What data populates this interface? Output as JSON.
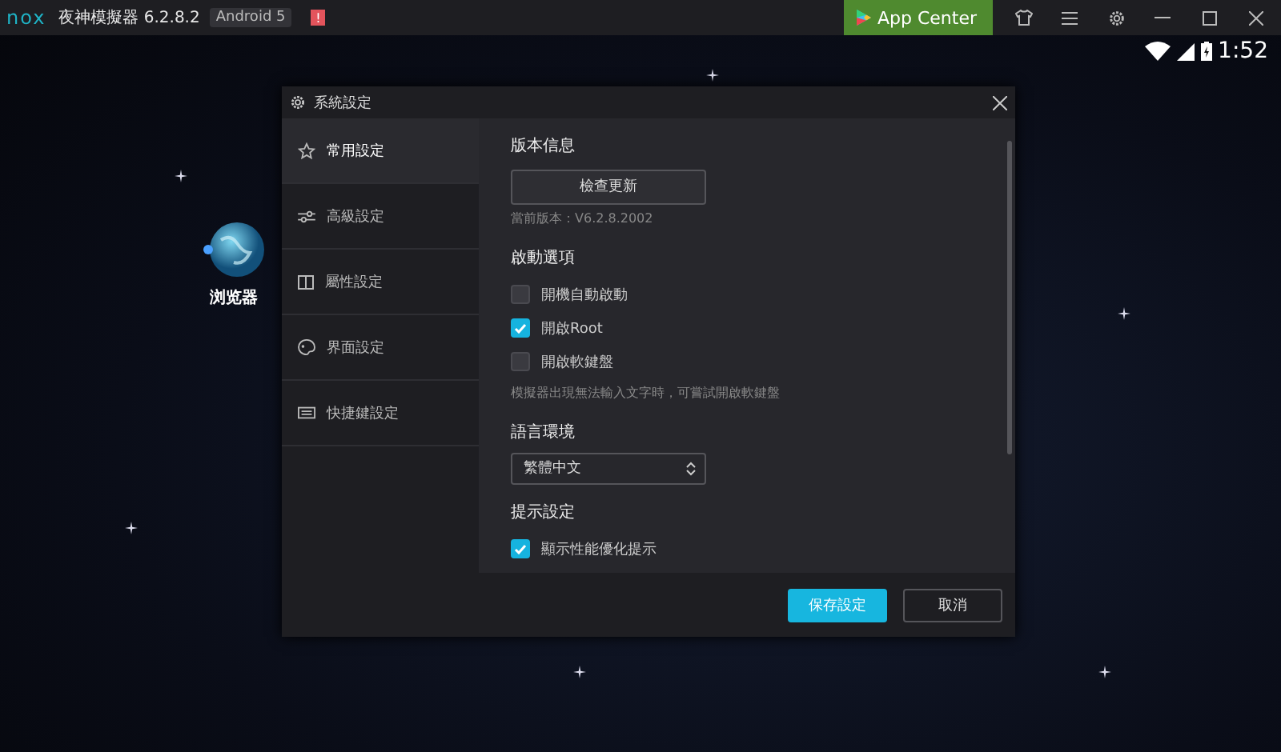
{
  "title_bar": {
    "logo": "nox",
    "app_name": "夜神模擬器 6.2.8.2",
    "badge": "Android 5",
    "alert": "!",
    "app_center": "App Center"
  },
  "status_bar": {
    "time": "1:52"
  },
  "desktop_icons": [
    {
      "label": "浏览器"
    }
  ],
  "dialog": {
    "title": "系統設定",
    "nav": [
      {
        "label": "常用設定",
        "selected": true
      },
      {
        "label": "高級設定",
        "selected": false
      },
      {
        "label": "屬性設定",
        "selected": false
      },
      {
        "label": "界面設定",
        "selected": false
      },
      {
        "label": "快捷鍵設定",
        "selected": false
      }
    ],
    "content": [
      {
        "kind": "heading",
        "text": "版本信息"
      },
      {
        "kind": "button",
        "text": "檢查更新"
      },
      {
        "kind": "note",
        "text": "當前版本：V6.2.8.2002"
      },
      {
        "kind": "heading",
        "text": "啟動選項"
      },
      {
        "kind": "checkbox",
        "text": "開機自動啟動",
        "checked": false
      },
      {
        "kind": "checkbox",
        "text": "開啟Root",
        "checked": true
      },
      {
        "kind": "checkbox",
        "text": "開啟軟鍵盤",
        "checked": false
      },
      {
        "kind": "note",
        "text": "模擬器出現無法輸入文字時，可嘗試開啟軟鍵盤"
      },
      {
        "kind": "heading",
        "text": "語言環境"
      },
      {
        "kind": "select",
        "text": "繁體中文"
      },
      {
        "kind": "heading",
        "text": "提示設定"
      },
      {
        "kind": "checkbox",
        "text": "顯示性能優化提示",
        "checked": true
      }
    ],
    "buttons": [
      {
        "label": "保存設定",
        "primary": true
      },
      {
        "label": "取消",
        "primary": false
      }
    ]
  }
}
